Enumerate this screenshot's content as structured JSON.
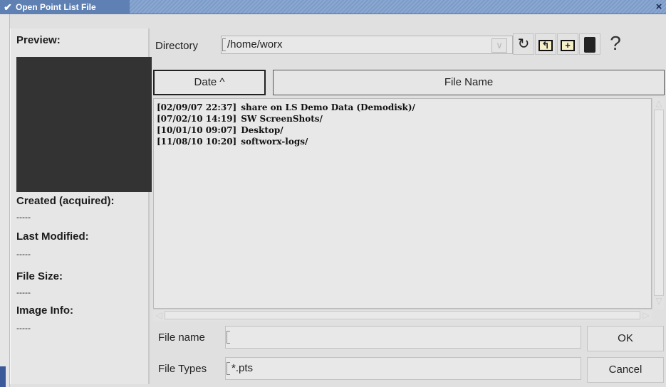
{
  "window": {
    "title": "Open Point List File",
    "close_glyph": "×"
  },
  "preview": {
    "preview_label": "Preview:",
    "created_label": "Created (acquired):",
    "created_value": "-----",
    "modified_label": "Last Modified:",
    "modified_value": "-----",
    "size_label": "File Size:",
    "size_value": "-----",
    "info_label": "Image Info:",
    "info_value": "-----"
  },
  "directory": {
    "label": "Directory",
    "value": "/home/worx"
  },
  "toolbar": {
    "icons": [
      "refresh-icon",
      "parent-directory-icon",
      "new-folder-icon",
      "trash-icon",
      "help-icon"
    ],
    "help_glyph": "?"
  },
  "columns": {
    "date": "Date ^",
    "name": "File Name"
  },
  "files": [
    {
      "date": "[02/09/07 22:37]",
      "name": "share on LS Demo Data (Demodisk)/"
    },
    {
      "date": "[07/02/10 14:19]",
      "name": "SW ScreenShots/"
    },
    {
      "date": "[10/01/10 09:07]",
      "name": "Desktop/"
    },
    {
      "date": "[11/08/10 10:20]",
      "name": "softworx-logs/"
    }
  ],
  "filename": {
    "label": "File name",
    "value": ""
  },
  "filetypes": {
    "label": "File Types",
    "value": "*.pts"
  },
  "buttons": {
    "ok": "OK",
    "cancel": "Cancel"
  },
  "colors": {
    "title_bar": "#5f80b2",
    "preview_box": "#333333",
    "background": "#e6e6e6"
  }
}
